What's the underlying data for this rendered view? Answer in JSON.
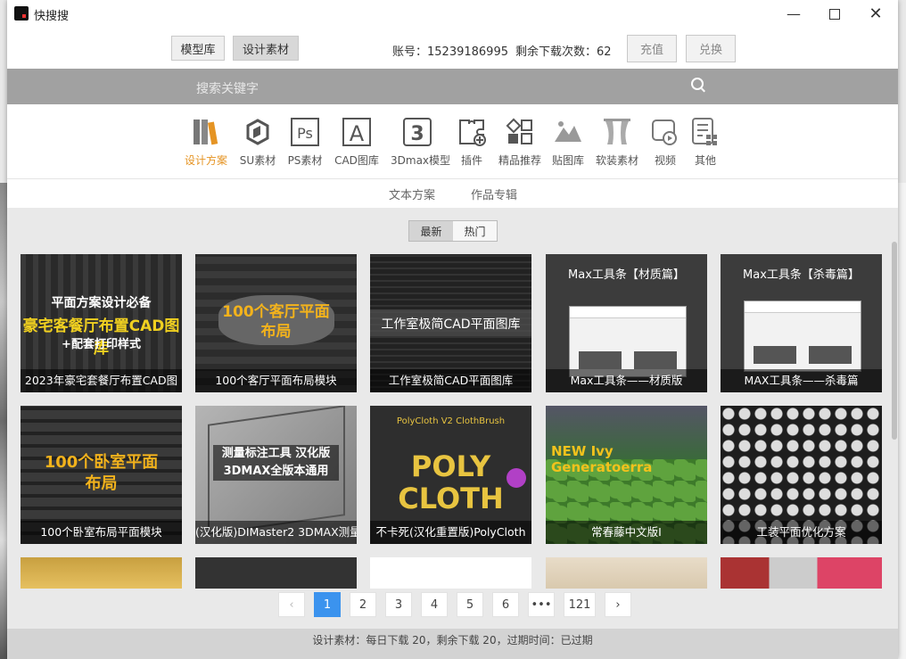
{
  "window": {
    "title": "快搜搜"
  },
  "header": {
    "tabs": [
      "模型库",
      "设计素材"
    ],
    "account_label": "账号：15239186995",
    "remaining_label": "剩余下载次数：62",
    "recharge": "充值",
    "exchange": "兑换"
  },
  "search": {
    "placeholder": "搜索关键字"
  },
  "categories": [
    {
      "label": "设计方案",
      "icon": "binders-icon",
      "active": true
    },
    {
      "label": "SU素材",
      "icon": "sketchup-icon"
    },
    {
      "label": "PS素材",
      "icon": "ps-icon"
    },
    {
      "label": "CAD图库",
      "icon": "cad-icon"
    },
    {
      "label": "3Dmax模型",
      "icon": "3dmax-icon"
    },
    {
      "label": "插件",
      "icon": "puzzle-icon"
    },
    {
      "label": "精品推荐",
      "icon": "recommend-icon"
    },
    {
      "label": "贴图库",
      "icon": "texture-icon"
    },
    {
      "label": "软装素材",
      "icon": "curtain-icon"
    },
    {
      "label": "视频",
      "icon": "video-icon"
    },
    {
      "label": "其他",
      "icon": "other-icon"
    }
  ],
  "subtabs": [
    "文本方案",
    "作品专辑"
  ],
  "sort": [
    "最新",
    "热门"
  ],
  "cards": [
    {
      "caption": "2023年豪宅套餐厅布置CAD图",
      "overlay": "豪宅客餐厅布置CAD图库"
    },
    {
      "caption": "100个客厅平面布局模块",
      "overlay": "100个客厅平面布局"
    },
    {
      "caption": "工作室极简CAD平面图库",
      "overlay": "工作室极简CAD平面图库"
    },
    {
      "caption": "Max工具条——材质版",
      "overlay": "Max工具条【材质篇】"
    },
    {
      "caption": "MAX工具条——杀毒篇",
      "overlay": "Max工具条【杀毒篇】"
    },
    {
      "caption": "100个卧室布局平面模块",
      "overlay": "100个卧室平面布局"
    },
    {
      "caption": "(汉化版)DIMaster2 3DMAX测量",
      "overlay": "测量标注工具 汉化版 3DMAX全版本通用"
    },
    {
      "caption": "不卡死(汉化重置版)PolyCloth",
      "overlay": "POLY CLOTH"
    },
    {
      "caption": "常春藤中文版Ⅰ",
      "overlay": "NEW Ivy Generatoerra"
    },
    {
      "caption": "工装平面优化方案",
      "overlay": ""
    }
  ],
  "pagination": {
    "pages": [
      "1",
      "2",
      "3",
      "4",
      "5",
      "6",
      "•••",
      "121"
    ],
    "current": "1",
    "prev": "‹",
    "next": "›"
  },
  "status": "设计素材：每日下载 20，剩余下载 20，过期时间：已过期"
}
